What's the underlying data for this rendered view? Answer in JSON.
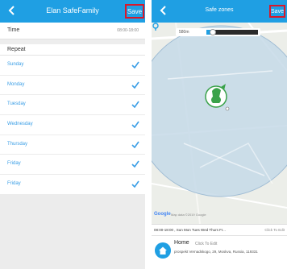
{
  "left": {
    "title": "Elan SafeFamily",
    "save_label": "Save",
    "time_label": "Time",
    "time_value": "08:00-18:00",
    "repeat_label": "Repeat",
    "days": [
      {
        "label": "Sunday",
        "checked": true
      },
      {
        "label": "Monday",
        "checked": true
      },
      {
        "label": "Tuesday",
        "checked": true
      },
      {
        "label": "Wednesday",
        "checked": true
      },
      {
        "label": "Thursday",
        "checked": true
      },
      {
        "label": "Friday",
        "checked": true
      },
      {
        "label": "Friday",
        "checked": true
      }
    ]
  },
  "right": {
    "title": "Safe zones",
    "save_label": "Save",
    "radius_label": "580m",
    "radius_fraction": 0.12,
    "google_label": "Google",
    "map_terms": "Map data ©2019 Google",
    "schedule_summary": "08:00-18:00 , Sun Mon Tues Wed Thurs Fr...",
    "schedule_edit": "Click To Edit",
    "home_name": "Home",
    "home_edit": "Click To Edit",
    "home_address": "prospekt Vernadskogo, 29, Moskva, Russia, 119331"
  },
  "colors": {
    "accent": "#1f9fe3",
    "save_border": "#d9182a",
    "check": "#3a9ee6",
    "zone_fill": "#c5d9e8",
    "avatar_green": "#3aa24a"
  },
  "icons": {
    "back": "chevron-left-icon",
    "check": "checkmark-icon",
    "location": "location-pin-icon",
    "home": "home-icon"
  }
}
